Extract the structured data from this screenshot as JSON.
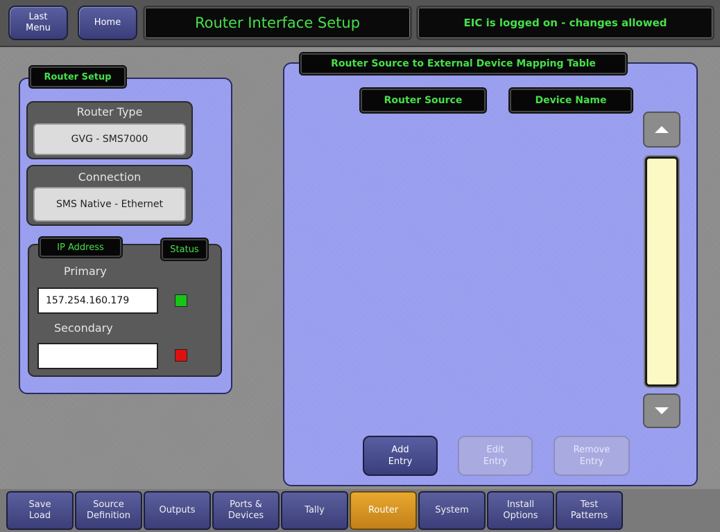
{
  "header": {
    "last_menu_label": "Last\nMenu",
    "home_label": "Home",
    "title": "Router Interface Setup",
    "status": "EIC is logged on - changes allowed"
  },
  "router_setup": {
    "heading": "Router Setup",
    "router_type_label": "Router Type",
    "router_type_value": "GVG - SMS7000",
    "connection_label": "Connection",
    "connection_value": "SMS Native - Ethernet",
    "ip_address_label": "IP Address",
    "status_label": "Status",
    "primary_label": "Primary",
    "primary_value": "157.254.160.179",
    "primary_status_color": "#17c417",
    "secondary_label": "Secondary",
    "secondary_value": "",
    "secondary_status_color": "#e01010"
  },
  "mapping_table": {
    "heading": "Router Source to External Device Mapping Table",
    "col_router_source": "Router Source",
    "col_device_name": "Device Name",
    "rows": [],
    "add_entry_label": "Add\nEntry",
    "edit_entry_label": "Edit\nEntry",
    "remove_entry_label": "Remove\nEntry"
  },
  "tabs": [
    {
      "label": "Save\nLoad",
      "active": false
    },
    {
      "label": "Source\nDefinition",
      "active": false
    },
    {
      "label": "Outputs",
      "active": false
    },
    {
      "label": "Ports &\nDevices",
      "active": false
    },
    {
      "label": "Tally",
      "active": false
    },
    {
      "label": "Router",
      "active": true
    },
    {
      "label": "System",
      "active": false
    },
    {
      "label": "Install\nOptions",
      "active": false
    },
    {
      "label": "Test\nPatterns",
      "active": false
    }
  ],
  "colors": {
    "accent_green": "#46e04a",
    "panel_blue": "#9a9ff2",
    "active_tab": "#e9a82e"
  }
}
